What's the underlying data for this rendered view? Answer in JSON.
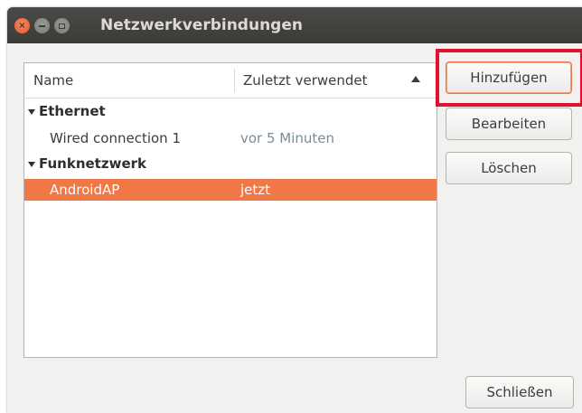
{
  "window": {
    "title": "Netzwerkverbindungen"
  },
  "list": {
    "columns": [
      "Name",
      "Zuletzt verwendet"
    ],
    "groups": [
      {
        "label": "Ethernet",
        "connections": [
          {
            "name": "Wired connection 1",
            "last_used": "vor 5 Minuten",
            "selected": false
          }
        ]
      },
      {
        "label": "Funknetzwerk",
        "connections": [
          {
            "name": "AndroidAP",
            "last_used": "jetzt",
            "selected": true
          }
        ]
      }
    ]
  },
  "buttons": {
    "add": "Hinzufügen",
    "edit": "Bearbeiten",
    "delete": "Löschen",
    "close": "Schließen"
  },
  "colors": {
    "selection": "#f07746",
    "highlight": "#e1122d"
  },
  "icons": [
    "close-icon",
    "minimize-icon",
    "maximize-icon",
    "sort-ascending-icon",
    "expander-icon"
  ]
}
